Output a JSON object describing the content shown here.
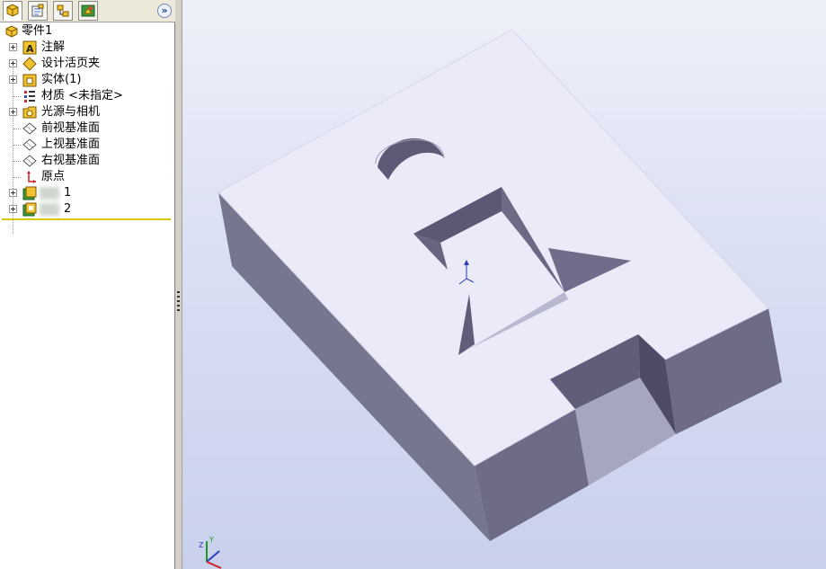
{
  "tabs": [
    {
      "icon": "feature-manager-icon"
    },
    {
      "icon": "property-manager-icon"
    },
    {
      "icon": "configuration-manager-icon"
    },
    {
      "icon": "dim-xpert-icon"
    }
  ],
  "panel": {
    "collapse_label": "»"
  },
  "tree": {
    "root": {
      "label": "零件1",
      "icon": "part-icon"
    },
    "items": [
      {
        "label": "注解",
        "icon": "annotations-icon",
        "expandable": true
      },
      {
        "label": "设计活页夹",
        "icon": "design-binder-icon",
        "expandable": true
      },
      {
        "label": "实体(1)",
        "icon": "solid-bodies-icon",
        "expandable": true
      },
      {
        "label": "材质 <未指定>",
        "icon": "material-icon",
        "expandable": false
      },
      {
        "label": "光源与相机",
        "icon": "lights-cameras-icon",
        "expandable": true
      },
      {
        "label": "前视基准面",
        "icon": "plane-icon",
        "expandable": false
      },
      {
        "label": "上视基准面",
        "icon": "plane-icon",
        "expandable": false
      },
      {
        "label": "右视基准面",
        "icon": "plane-icon",
        "expandable": false
      },
      {
        "label": "原点",
        "icon": "origin-icon",
        "expandable": false
      },
      {
        "label": "1",
        "icon": "extrude-feature-icon",
        "expandable": true
      },
      {
        "label": "2",
        "icon": "cut-feature-icon",
        "expandable": true
      }
    ]
  },
  "colors": {
    "model_top": "#eaeaf8",
    "model_side_dark": "#6e6c86",
    "model_side_light": "#8a8aa8",
    "viewport_bg": "#dadff3",
    "rollback_bar": "#d9c900"
  }
}
